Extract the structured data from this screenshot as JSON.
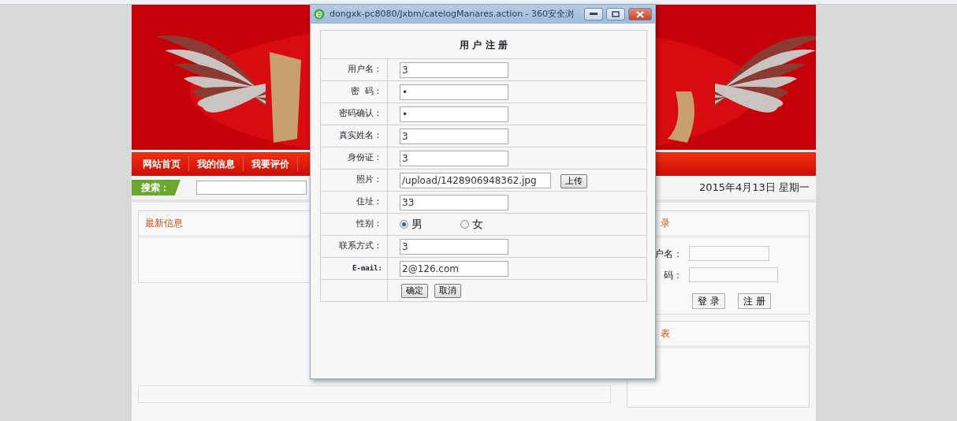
{
  "site": {
    "nav": [
      {
        "label": "网站首页"
      },
      {
        "label": "我的信息"
      },
      {
        "label": "我要评价"
      }
    ],
    "search": {
      "label": "搜索："
    },
    "date": "2015年4月13日 星期一",
    "news_panel": {
      "title": "最新信息"
    },
    "login_panel": {
      "title": "录",
      "fields": [
        {
          "label": "户名："
        },
        {
          "label": "码："
        }
      ],
      "buttons": [
        "登 录",
        "注 册"
      ]
    },
    "list_panel": {
      "title": "表"
    }
  },
  "popup": {
    "title": "dongxk-pc8080/Jxbm/catelogManares.action - 360安全浏",
    "form": {
      "title": "用 户 注 册",
      "rows": [
        {
          "kind": "text",
          "label": "用户名：",
          "value": "3"
        },
        {
          "kind": "text",
          "label": "密  码：",
          "value": "•"
        },
        {
          "kind": "text",
          "label": "密码确认：",
          "value": "•"
        },
        {
          "kind": "text",
          "label": "真实姓名：",
          "value": "3"
        },
        {
          "kind": "text",
          "label": "身份证：",
          "value": "3"
        },
        {
          "kind": "file",
          "label": "照片：",
          "value": "/upload/1428906948362.jpg",
          "button": "上传"
        },
        {
          "kind": "text",
          "label": "住址：",
          "value": "33"
        },
        {
          "kind": "radio",
          "label": "性别：",
          "options": [
            {
              "label": "男",
              "selected": true
            },
            {
              "label": "女",
              "selected": false
            }
          ]
        },
        {
          "kind": "text",
          "label": "联系方式：",
          "value": "3"
        },
        {
          "kind": "mono",
          "label": "E-mail:",
          "value": "2@126.com"
        }
      ],
      "buttons": [
        "确定",
        "取消"
      ]
    }
  }
}
